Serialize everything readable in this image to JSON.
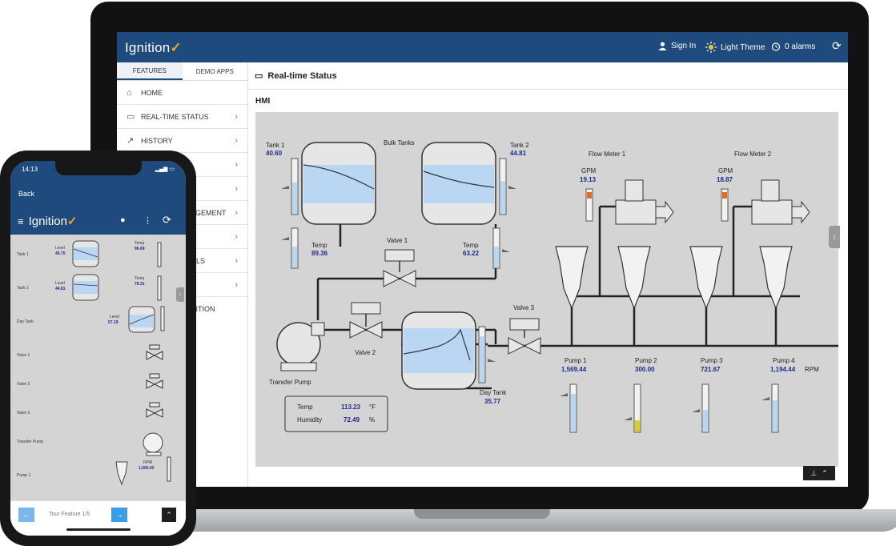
{
  "app": {
    "logo_text": "Ignition",
    "logo_mark": "✓",
    "sign_in": "Sign In",
    "theme": "Light Theme",
    "alarms": "0 alarms"
  },
  "sidebar": {
    "tabs": [
      {
        "label": "FEATURES"
      },
      {
        "label": "DEMO APPS"
      }
    ],
    "items": [
      {
        "label": "HOME",
        "icon": "home-icon"
      },
      {
        "label": "REAL-TIME STATUS",
        "icon": "monitor-icon"
      },
      {
        "label": "HISTORY",
        "icon": "trend-icon"
      },
      {
        "label": "",
        "icon": ""
      },
      {
        "label": "",
        "icon": ""
      },
      {
        "label": "AGEMENT",
        "icon": ""
      },
      {
        "label": "",
        "icon": ""
      },
      {
        "label": "OLS",
        "icon": ""
      },
      {
        "label": "",
        "icon": ""
      },
      {
        "label": "NITION",
        "icon": ""
      }
    ]
  },
  "page": {
    "title": "Real-time Status",
    "section": "HMI"
  },
  "hmi": {
    "bulk_tanks_label": "Bulk Tanks",
    "tank1": {
      "label": "Tank 1",
      "value": "40.60"
    },
    "tank2": {
      "label": "Tank 2",
      "value": "44.81"
    },
    "temp1": {
      "label": "Temp",
      "value": "89.36"
    },
    "temp2": {
      "label": "Temp",
      "value": "63.22"
    },
    "valve1": "Valve 1",
    "valve2": "Valve 2",
    "valve3": "Valve 3",
    "transfer_pump": "Transfer Pump",
    "day_tank": {
      "label": "Day Tank",
      "value": "35.77"
    },
    "env": {
      "temp_label": "Temp",
      "temp_value": "113.23",
      "temp_unit": "°F",
      "hum_label": "Humidity",
      "hum_value": "72.49",
      "hum_unit": "%"
    },
    "flow_meter1": {
      "label": "Flow Meter 1",
      "unit": "GPM",
      "value": "19.13"
    },
    "flow_meter2": {
      "label": "Flow Meter 2",
      "unit": "GPM",
      "value": "18.87"
    },
    "pumps": [
      {
        "label": "Pump 1",
        "value": "1,569.44"
      },
      {
        "label": "Pump 2",
        "value": "300.00"
      },
      {
        "label": "Pump 3",
        "value": "721.67"
      },
      {
        "label": "Pump 4",
        "value": "1,194.44"
      }
    ],
    "rpm_unit": "RPM",
    "value_color": "#1e2a8a"
  },
  "phone": {
    "time": "14:13",
    "back": "Back",
    "logo_text": "Ignition",
    "rows": [
      {
        "label": "Tank 1",
        "level_label": "Level",
        "level": "45.70",
        "temp_label": "Temp",
        "temp": "96.69"
      },
      {
        "label": "Tank 2",
        "level_label": "Level",
        "level": "44.81",
        "temp_label": "Temp",
        "temp": "78.31"
      },
      {
        "label": "Day Tank",
        "level_label": "Level",
        "level": "57.19"
      },
      {
        "label": "Valve 1"
      },
      {
        "label": "Valve 2"
      },
      {
        "label": "Valve 3"
      },
      {
        "label": "Transfer Pump"
      },
      {
        "label": "Pump 1",
        "rpm_label": "RPM",
        "rpm": "1,500.00"
      }
    ],
    "footer": "Tour Feature 1/5"
  },
  "colors": {
    "topbar": "#1e4a7d",
    "accent": "#f2a21b",
    "hmi_bg": "#d4d4d4",
    "liquid": "#b9d7f2"
  }
}
